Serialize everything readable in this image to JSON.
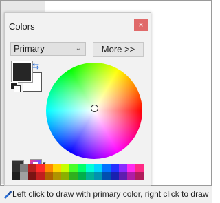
{
  "panel": {
    "title": "Colors",
    "close_label": "×",
    "mode_select": "Primary",
    "more_button": "More >>"
  },
  "colors": {
    "primary": "#262626",
    "secondary": "#ffffff",
    "close_bg": "#e06a6a"
  },
  "palette_row_1": [
    "#303030",
    "#7f7f7f",
    "#b51f1f",
    "#ff2a2a",
    "#ff8a00",
    "#ffd400",
    "#c8ff00",
    "#47ff2a",
    "#00ff6c",
    "#00ffd8",
    "#00d6ff",
    "#0074ff",
    "#2430ff",
    "#8a2aff",
    "#ff2af0",
    "#ff2a86"
  ],
  "palette_row_2": [
    "#1e1e1e",
    "#a0a0a0",
    "#7a1414",
    "#c21e1e",
    "#b06200",
    "#b09300",
    "#8bb000",
    "#2fb01d",
    "#00b04b",
    "#00b096",
    "#0093b0",
    "#004fb0",
    "#1821b0",
    "#5f1db0",
    "#b01da6",
    "#b01d5c"
  ],
  "icons": [
    "swap-arrows-icon",
    "reset-colors-icon",
    "add-color-icon",
    "palette-icon",
    "dropdown-arrow-icon",
    "paintbrush-icon"
  ],
  "status": {
    "text": "Left click to draw with primary color, right click to draw"
  }
}
